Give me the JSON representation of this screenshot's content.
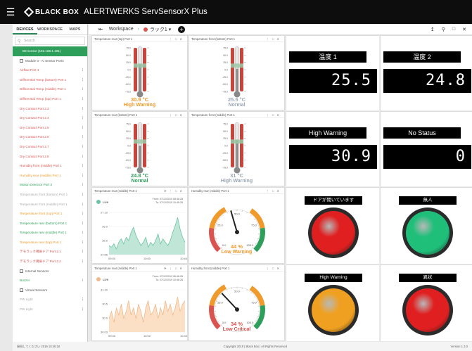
{
  "topbar": {
    "brand": "BLACK BOX",
    "app_title": "ALERTWERKS ServSensorX Plus"
  },
  "sidebar": {
    "tabs": [
      "DEVICES",
      "WORKSPACE",
      "MAPS"
    ],
    "search_placeholder": "Search",
    "items": [
      {
        "label": "B8 sensor (192.168.1.101)",
        "style": "sel"
      },
      {
        "label": "Module 0 - Ai Sensor Ports",
        "style": "grp"
      },
      {
        "label": "Airflow Port 4",
        "style": "red"
      },
      {
        "label": "Differential Temp (bottom) Port 1",
        "style": "red"
      },
      {
        "label": "Differential Temp (middle) Port 1",
        "style": "red"
      },
      {
        "label": "Differential Temp (top) Port 1",
        "style": "red"
      },
      {
        "label": "Dry Contact Port 2.3",
        "style": "red"
      },
      {
        "label": "Dry Contact Port 2.4",
        "style": "red"
      },
      {
        "label": "Dry Contact Port 2.5",
        "style": "red"
      },
      {
        "label": "Dry Contact Port 2.6",
        "style": "red"
      },
      {
        "label": "Dry Contact Port 2.7",
        "style": "red"
      },
      {
        "label": "Dry Contact Port 2.8",
        "style": "red"
      },
      {
        "label": "Humidity front (middle) Port 1",
        "style": "red"
      },
      {
        "label": "Humidity rear (middle) Port 1",
        "style": "org"
      },
      {
        "label": "Motion Detector Port 3",
        "style": "grn"
      },
      {
        "label": "Temperature front (bottom) Port 1",
        "style": "gry"
      },
      {
        "label": "Temperature front (middle) Port 1",
        "style": "gry"
      },
      {
        "label": "Temperature front (top) Port 1",
        "style": "org"
      },
      {
        "label": "Temperature rear (bottom) Port 1",
        "style": "grn"
      },
      {
        "label": "Temperature rear (middle) Port 1",
        "style": "grn"
      },
      {
        "label": "Temperature rear (top) Port 1",
        "style": "org"
      },
      {
        "label": "デモラック用扉ドア Port 2.1",
        "style": "red"
      },
      {
        "label": "デモラック用扉ドア Port 2.2",
        "style": "red"
      },
      {
        "label": "Internal Sensors",
        "style": "grp"
      },
      {
        "label": "Buzzer",
        "style": "grn"
      },
      {
        "label": "Virtual Sensors",
        "style": "grp"
      },
      {
        "label": "PW Light",
        "style": "gry"
      },
      {
        "label": "PW Light",
        "style": "gry"
      }
    ]
  },
  "crumb": {
    "workspace": "Workspace",
    "rack": "ラック1"
  },
  "thermos": [
    {
      "title": "Temperature rear (top) Port 1",
      "value": "30.9 °C",
      "status": "High Warning",
      "color": "#ef9a2a",
      "fill": 0.62
    },
    {
      "title": "Temperature front (bottom) Port 1",
      "value": "25.5 °C",
      "status": "Normal",
      "color": "#9aa6b5",
      "fill": 0.52
    },
    {
      "title": "Temperature rear (bottom) Port 1",
      "value": "24.8 °C",
      "status": "Normal",
      "color": "#2e9e5b",
      "fill": 0.5
    },
    {
      "title": "Temperature front (middle) Port 1",
      "value": "31 °C",
      "status": "High Warning",
      "color": "#9aa6b5",
      "fill": 0.63
    }
  ],
  "thermo_ticks": [
    "75.0",
    "50.0",
    "25.0",
    "0.0",
    "-25.0",
    "-50.0",
    "-75.0"
  ],
  "charts": [
    {
      "title": "Temperature rear (middle) Port 1",
      "legend": "Live",
      "range_from": "From: 07/12/2019 08:46:28",
      "range_to": "To: 07/12/2019 10:46:28",
      "color": "#6cc4a4",
      "fill": "#bfe6d6",
      "yticks": [
        "27.10",
        "26.0",
        "25.0",
        "24.55"
      ],
      "xticks": [
        "09:00",
        "10:00",
        "10:46"
      ],
      "chart_data": {
        "type": "area",
        "ylim": [
          24.55,
          27.1
        ],
        "values": [
          25.1,
          25.0,
          25.2,
          24.9,
          25.3,
          25.5,
          25.2,
          25.6,
          25.4,
          25.9,
          26.2,
          25.7,
          25.4,
          25.1,
          25.3,
          25.6,
          25.0,
          25.3,
          25.1,
          25.4,
          25.8,
          25.2,
          25.5,
          25.3,
          25.1,
          25.4,
          25.9,
          26.3,
          26.8,
          26.1,
          25.6,
          25.3
        ]
      }
    },
    {
      "title": "Temperature rear (middle) Port 1",
      "legend": "Live",
      "range_from": "From: 07/12/2019 08:46:28",
      "range_to": "To: 07/12/2019 10:46:28",
      "color": "#f0b98a",
      "fill": "#fbe0c6",
      "yticks": [
        "31.20",
        "30.5",
        "30.0",
        "30.03"
      ],
      "xticks": [
        "09:00",
        "10:00",
        "10:46"
      ],
      "chart_data": {
        "type": "area",
        "ylim": [
          30.03,
          31.2
        ],
        "values": [
          30.4,
          30.6,
          30.3,
          30.7,
          30.5,
          30.8,
          30.4,
          30.6,
          30.9,
          30.5,
          30.7,
          30.4,
          30.8,
          30.6,
          30.3,
          30.7,
          30.9,
          30.5,
          30.6,
          30.8,
          30.4,
          30.7,
          30.5,
          30.9,
          30.6,
          30.8,
          30.5,
          30.7,
          31.0,
          30.6,
          30.8,
          30.9
        ]
      }
    }
  ],
  "gauges": [
    {
      "title": "Humidity rear (middle) Port 1",
      "value": "44 %",
      "status": "Low Warning",
      "color": "#ef9a2a",
      "level": 0.44
    },
    {
      "title": "Humidity front (middle) Port 1",
      "value": "34 %",
      "status": "Low Critical",
      "color": "#d9534f",
      "level": 0.34
    }
  ],
  "gauge_ticks": [
    "0.0",
    "25.0",
    "50.0",
    "75.0",
    "100.0"
  ],
  "digital": [
    {
      "label": "温度 1",
      "value": "25.5"
    },
    {
      "label": "温度 2",
      "value": "24.8"
    },
    {
      "label": "High Warning",
      "value": "30.9"
    },
    {
      "label": "No Status",
      "value": "0"
    }
  ],
  "lamps": [
    {
      "label": "ドアが開いています",
      "color": "#e02020"
    },
    {
      "label": "無人",
      "color": "#1fbf7a"
    },
    {
      "label": "High Warning",
      "color": "#f0a020"
    },
    {
      "label": "異状",
      "color": "#e02020"
    }
  ],
  "status": {
    "left": "接続してください 2019 10:46:18",
    "center": "Copyright 2019 | Black Box | All Rights Reserved",
    "right": "Version 1.3.0"
  }
}
